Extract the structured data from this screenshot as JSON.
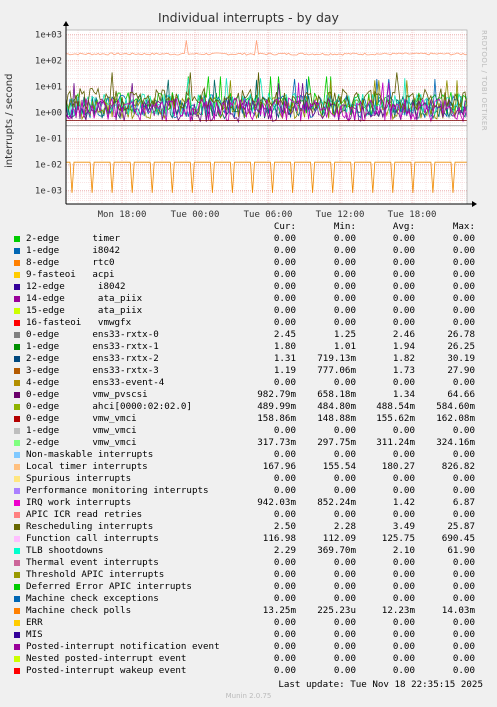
{
  "chart_data": {
    "type": "line",
    "title": "Individual interrupts - by day",
    "ylabel": "interrupts / second",
    "y_scale": "log",
    "ylim": [
      0.0003,
      1500
    ],
    "yticks": [
      "1e+03",
      "1e+02",
      "1e+01",
      "1e+00",
      "1e-01",
      "1e-02",
      "1e-03"
    ],
    "xticks": [
      "Mon 18:00",
      "Tue 00:00",
      "Tue 06:00",
      "Tue 12:00",
      "Tue 18:00"
    ],
    "grid": true,
    "series_summary": [
      {
        "name": "Local timer interrupts",
        "color": "#FFA07A",
        "level": 180
      },
      {
        "name": "ens33-rxtx-0",
        "color": "#00CC00",
        "level": 2.46
      },
      {
        "name": "ens33-rxtx-1",
        "color": "#0066B3",
        "level": 1.94
      },
      {
        "name": "ens33-rxtx-2",
        "color": "#006666",
        "level": 1.82
      },
      {
        "name": "ens33-rxtx-3",
        "color": "#8E8E00",
        "level": 1.73
      },
      {
        "name": "TLB shootdowns",
        "color": "#1AE5B8",
        "level": 2.1
      },
      {
        "name": "vmw_pvscsi",
        "color": "#6D0F8C",
        "level": 1.34
      },
      {
        "name": "Rescheduling interrupts",
        "color": "#5C5C00",
        "level": 3.49
      },
      {
        "name": "IRQ work interrupts",
        "color": "#BE00BE",
        "level": 1.42
      },
      {
        "name": "ahci[0000:02:02.0]",
        "color": "#7A0000",
        "level": 0.4885
      },
      {
        "name": "vmw_vmci",
        "color": "#A3A3A3",
        "level": 0.311
      },
      {
        "name": "Machine check polls",
        "color": "#F08A00",
        "level": 0.01223
      }
    ]
  },
  "legend": {
    "headers": {
      "cur": "Cur:",
      "min": "Min:",
      "avg": "Avg:",
      "max": "Max:"
    },
    "rows": [
      {
        "color": "#00CC00",
        "label": "2-edge      timer",
        "cur": "0.00",
        "min": "0.00",
        "avg": "0.00",
        "max": "0.00"
      },
      {
        "color": "#0066B3",
        "label": "1-edge      i8042",
        "cur": "0.00",
        "min": "0.00",
        "avg": "0.00",
        "max": "0.00"
      },
      {
        "color": "#FF8000",
        "label": "8-edge      rtc0",
        "cur": "0.00",
        "min": "0.00",
        "avg": "0.00",
        "max": "0.00"
      },
      {
        "color": "#FFCC00",
        "label": "9-fasteoi   acpi",
        "cur": "0.00",
        "min": "0.00",
        "avg": "0.00",
        "max": "0.00"
      },
      {
        "color": "#330099",
        "label": "12-edge      i8042",
        "cur": "0.00",
        "min": "0.00",
        "avg": "0.00",
        "max": "0.00"
      },
      {
        "color": "#990099",
        "label": "14-edge      ata_piix",
        "cur": "0.00",
        "min": "0.00",
        "avg": "0.00",
        "max": "0.00"
      },
      {
        "color": "#CCFF00",
        "label": "15-edge      ata_piix",
        "cur": "0.00",
        "min": "0.00",
        "avg": "0.00",
        "max": "0.00"
      },
      {
        "color": "#FF0000",
        "label": "16-fasteoi   vmwgfx",
        "cur": "0.00",
        "min": "0.00",
        "avg": "0.00",
        "max": "0.00"
      },
      {
        "color": "#808080",
        "label": "0-edge      ens33-rxtx-0",
        "cur": "2.45",
        "min": "1.25",
        "avg": "2.46",
        "max": "26.78"
      },
      {
        "color": "#008F00",
        "label": "1-edge      ens33-rxtx-1",
        "cur": "1.80",
        "min": "1.01",
        "avg": "1.94",
        "max": "26.25"
      },
      {
        "color": "#00487D",
        "label": "2-edge      ens33-rxtx-2",
        "cur": "1.31",
        "min": "719.13m",
        "avg": "1.82",
        "max": "30.19"
      },
      {
        "color": "#B35A00",
        "label": "3-edge      ens33-rxtx-3",
        "cur": "1.19",
        "min": "777.06m",
        "avg": "1.73",
        "max": "27.90"
      },
      {
        "color": "#B38F00",
        "label": "4-edge      ens33-event-4",
        "cur": "0.00",
        "min": "0.00",
        "avg": "0.00",
        "max": "0.00"
      },
      {
        "color": "#6B006B",
        "label": "0-edge      vmw_pvscsi",
        "cur": "982.79m",
        "min": "658.18m",
        "avg": "1.34",
        "max": "64.66"
      },
      {
        "color": "#8FB300",
        "label": "0-edge      ahci[0000:02:02.0]",
        "cur": "489.99m",
        "min": "484.80m",
        "avg": "488.54m",
        "max": "584.60m"
      },
      {
        "color": "#B30000",
        "label": "0-edge      vmw_vmci",
        "cur": "158.86m",
        "min": "148.88m",
        "avg": "155.62m",
        "max": "162.08m"
      },
      {
        "color": "#BEBEBE",
        "label": "1-edge      vmw_vmci",
        "cur": "0.00",
        "min": "0.00",
        "avg": "0.00",
        "max": "0.00"
      },
      {
        "color": "#80FF80",
        "label": "2-edge      vmw_vmci",
        "cur": "317.73m",
        "min": "297.75m",
        "avg": "311.24m",
        "max": "324.16m"
      },
      {
        "color": "#80C9FF",
        "label": "Non-maskable interrupts",
        "cur": "0.00",
        "min": "0.00",
        "avg": "0.00",
        "max": "0.00"
      },
      {
        "color": "#FFC080",
        "label": "Local timer interrupts",
        "cur": "167.96",
        "min": "155.54",
        "avg": "180.27",
        "max": "826.82"
      },
      {
        "color": "#FFE680",
        "label": "Spurious interrupts",
        "cur": "0.00",
        "min": "0.00",
        "avg": "0.00",
        "max": "0.00"
      },
      {
        "color": "#AA80FF",
        "label": "Performance monitoring interrupts",
        "cur": "0.00",
        "min": "0.00",
        "avg": "0.00",
        "max": "0.00"
      },
      {
        "color": "#EE00CC",
        "label": "IRQ work interrupts",
        "cur": "942.03m",
        "min": "852.24m",
        "avg": "1.42",
        "max": "6.87"
      },
      {
        "color": "#FF8080",
        "label": "APIC ICR read retries",
        "cur": "0.00",
        "min": "0.00",
        "avg": "0.00",
        "max": "0.00"
      },
      {
        "color": "#666600",
        "label": "Rescheduling interrupts",
        "cur": "2.50",
        "min": "2.28",
        "avg": "3.49",
        "max": "25.87"
      },
      {
        "color": "#FFBFFF",
        "label": "Function call interrupts",
        "cur": "116.98",
        "min": "112.09",
        "avg": "125.75",
        "max": "690.45"
      },
      {
        "color": "#00FFCC",
        "label": "TLB shootdowns",
        "cur": "2.29",
        "min": "369.70m",
        "avg": "2.10",
        "max": "61.90"
      },
      {
        "color": "#CC6699",
        "label": "Thermal event interrupts",
        "cur": "0.00",
        "min": "0.00",
        "avg": "0.00",
        "max": "0.00"
      },
      {
        "color": "#999900",
        "label": "Threshold APIC interrupts",
        "cur": "0.00",
        "min": "0.00",
        "avg": "0.00",
        "max": "0.00"
      },
      {
        "color": "#00CC00",
        "label": "Deferred Error APIC interrupts",
        "cur": "0.00",
        "min": "0.00",
        "avg": "0.00",
        "max": "0.00"
      },
      {
        "color": "#0066B3",
        "label": "Machine check exceptions",
        "cur": "0.00",
        "min": "0.00",
        "avg": "0.00",
        "max": "0.00"
      },
      {
        "color": "#FF8000",
        "label": "Machine check polls",
        "cur": "13.25m",
        "min": "225.23u",
        "avg": "12.23m",
        "max": "14.03m"
      },
      {
        "color": "#FFCC00",
        "label": "ERR",
        "cur": "0.00",
        "min": "0.00",
        "avg": "0.00",
        "max": "0.00"
      },
      {
        "color": "#330099",
        "label": "MIS",
        "cur": "0.00",
        "min": "0.00",
        "avg": "0.00",
        "max": "0.00"
      },
      {
        "color": "#990099",
        "label": "Posted-interrupt notification event",
        "cur": "0.00",
        "min": "0.00",
        "avg": "0.00",
        "max": "0.00"
      },
      {
        "color": "#CCFF00",
        "label": "Nested posted-interrupt event",
        "cur": "0.00",
        "min": "0.00",
        "avg": "0.00",
        "max": "0.00"
      },
      {
        "color": "#FF0000",
        "label": "Posted-interrupt wakeup event",
        "cur": "0.00",
        "min": "0.00",
        "avg": "0.00",
        "max": "0.00"
      }
    ]
  },
  "last_update": "Last update: Tue Nov 18 22:35:15 2025",
  "munin_version": "Munin 2.0.75",
  "brand": "RRDTOOL / TOBI OETIKER"
}
